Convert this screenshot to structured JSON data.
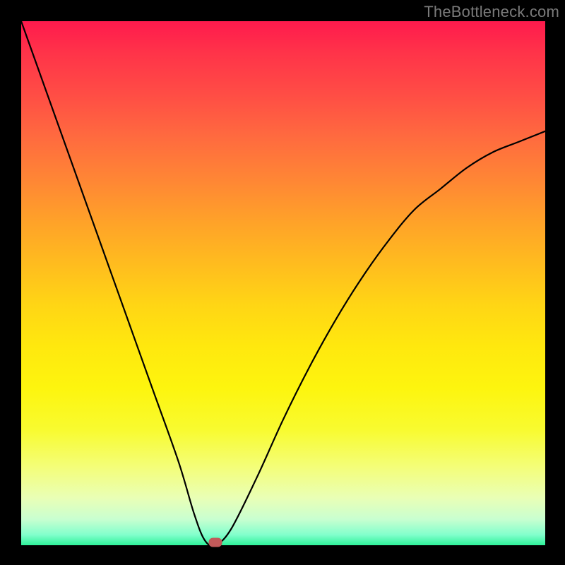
{
  "watermark": "TheBottleneck.com",
  "colors": {
    "frame": "#000000",
    "curve": "#000000",
    "marker": "#c25a5a"
  },
  "chart_data": {
    "type": "line",
    "title": "",
    "xlabel": "",
    "ylabel": "",
    "xlim": [
      0,
      100
    ],
    "ylim": [
      0,
      100
    ],
    "grid": false,
    "x": [
      0,
      5,
      10,
      15,
      20,
      25,
      30,
      33,
      35,
      37,
      40,
      45,
      50,
      55,
      60,
      65,
      70,
      75,
      80,
      85,
      90,
      95,
      100
    ],
    "values": [
      100,
      86,
      72,
      58,
      44,
      30,
      16,
      6,
      1,
      0,
      3,
      13,
      24,
      34,
      43,
      51,
      58,
      64,
      68,
      72,
      75,
      77,
      79
    ],
    "marker": {
      "x": 37,
      "y": 0
    },
    "background_gradient": {
      "type": "vertical",
      "stops": [
        {
          "pos": 0,
          "color": "#ff1a4d"
        },
        {
          "pos": 50,
          "color": "#ffd515"
        },
        {
          "pos": 85,
          "color": "#f4fe78"
        },
        {
          "pos": 100,
          "color": "#2ef29a"
        }
      ]
    }
  }
}
